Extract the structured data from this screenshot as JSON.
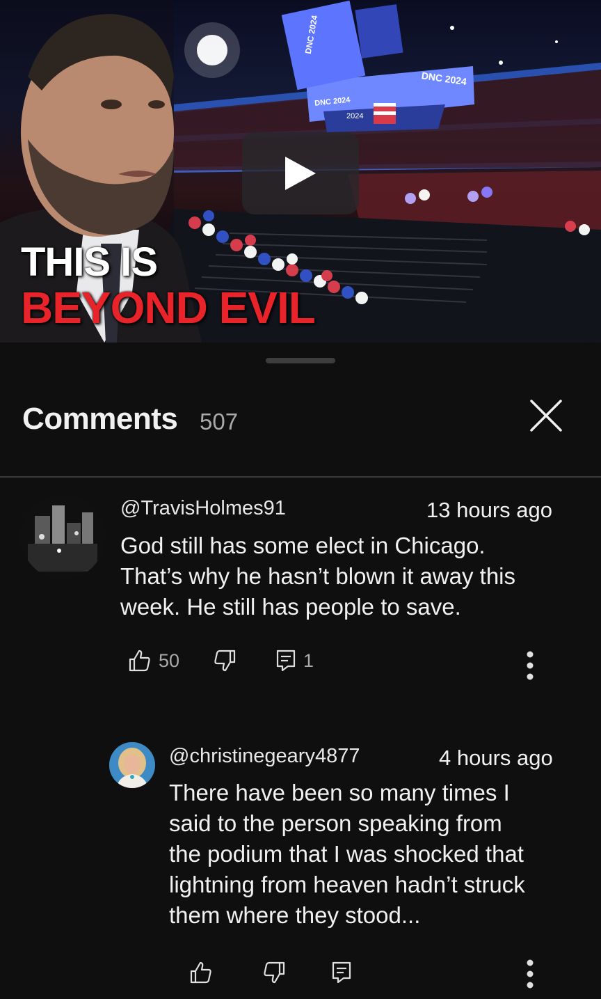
{
  "video": {
    "thumbnail_title_line1": "THIS IS",
    "thumbnail_title_line2": "BEYOND EVIL",
    "signage": [
      "DNC 2024",
      "DNC 2024",
      "2024",
      "DNC 2024"
    ],
    "play_icon": "play-icon"
  },
  "comments_panel": {
    "title": "Comments",
    "count": "507",
    "close_icon": "close-icon"
  },
  "comments": [
    {
      "author": "@TravisHolmes91",
      "time": "13 hours ago",
      "text_lines": [
        "God still has some elect in Chicago.",
        "That’s why he hasn’t blown it away this",
        "week. He still has people to save."
      ],
      "likes": "50",
      "replies": "1"
    },
    {
      "author": "@christinegeary4877",
      "time": "4 hours ago",
      "text_lines": [
        "There have been so many times I",
        "said to the person speaking from",
        "the podium that I was shocked that",
        "lightning from heaven hadn’t struck",
        "them where they stood..."
      ]
    }
  ],
  "colors": {
    "background": "#0f0f0f",
    "title_red": "#e8232a",
    "secondary_text": "#aaaaaa"
  }
}
